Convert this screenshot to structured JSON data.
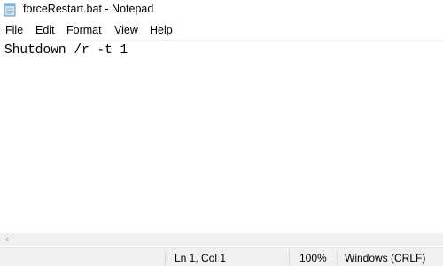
{
  "window": {
    "title": "forceRestart.bat - Notepad",
    "app_icon": "notepad-icon"
  },
  "menu": {
    "file": {
      "accel": "F",
      "rest": "ile"
    },
    "edit": {
      "accel": "E",
      "rest": "dit"
    },
    "format": {
      "pre": "F",
      "accel": "o",
      "rest": "rmat"
    },
    "view": {
      "accel": "V",
      "rest": "iew"
    },
    "help": {
      "accel": "H",
      "rest": "elp"
    }
  },
  "editor": {
    "content": "Shutdown /r -t 1"
  },
  "scrollbar": {
    "left_arrow_icon": "chevron-left-icon"
  },
  "status": {
    "position": "Ln 1, Col 1",
    "zoom": "100%",
    "line_ending": "Windows (CRLF)"
  }
}
